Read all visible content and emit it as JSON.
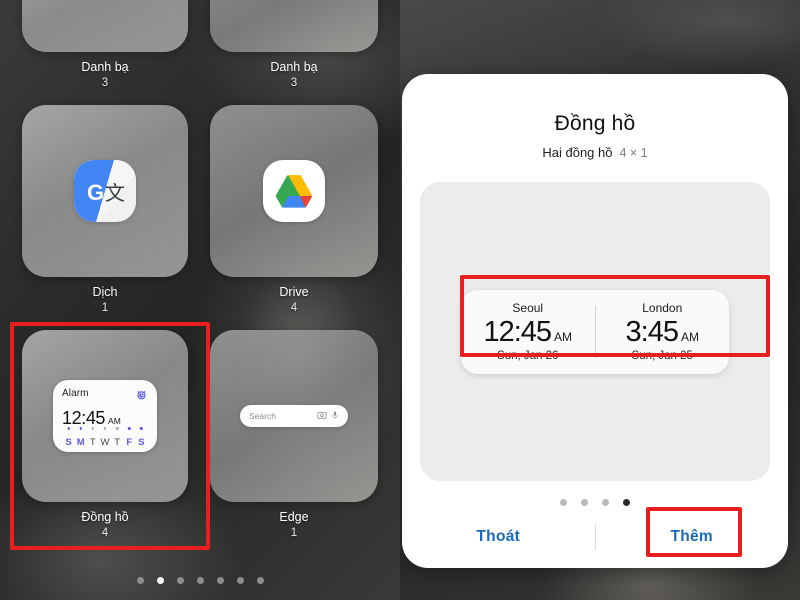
{
  "left_panel": {
    "name": "home-screen-widget-list",
    "widgets": [
      {
        "label": "Danh bạ",
        "count": "3",
        "icon": "contacts-widget-preview"
      },
      {
        "label": "Danh bạ",
        "count": "3",
        "icon": "contacts-widget-preview"
      },
      {
        "label": "Dịch",
        "count": "1",
        "icon": "google-translate-icon"
      },
      {
        "label": "Drive",
        "count": "4",
        "icon": "google-drive-icon"
      },
      {
        "label": "Đồng hồ",
        "count": "4",
        "icon": "alarm-widget-preview"
      },
      {
        "label": "Edge",
        "count": "1",
        "icon": "edge-search-widget-preview"
      }
    ],
    "alarm_widget": {
      "title": "Alarm",
      "time": "12:45",
      "ampm": "AM",
      "icon": "alarm-clock-icon",
      "days": [
        {
          "letter": "S",
          "active": true
        },
        {
          "letter": "M",
          "active": true
        },
        {
          "letter": "T",
          "active": false
        },
        {
          "letter": "W",
          "active": false
        },
        {
          "letter": "T",
          "active": false
        },
        {
          "letter": "F",
          "active": true
        },
        {
          "letter": "S",
          "active": true
        }
      ]
    },
    "edge_widget": {
      "placeholder": "Search",
      "camera_icon": "camera-icon",
      "mic_icon": "microphone-icon"
    },
    "page_dots": {
      "total": 7,
      "active_index": 1
    },
    "highlight_color": "#e81f1f"
  },
  "right_panel": {
    "name": "widget-add-dialog",
    "dialog": {
      "title": "Đồng hồ",
      "subtitle": "Hai đồng hồ",
      "size": "4 × 1",
      "preview": {
        "clocks": [
          {
            "city": "Seoul",
            "time": "12:45",
            "ampm": "AM",
            "date": "Sun, Jan 26"
          },
          {
            "city": "London",
            "time": "3:45",
            "ampm": "AM",
            "date": "Sun, Jan 25"
          }
        ]
      },
      "dots": {
        "total": 4,
        "active_index": 3
      },
      "actions": {
        "cancel_label": "Thoát",
        "add_label": "Thêm"
      },
      "accent_color": "#1a6bb5"
    }
  }
}
